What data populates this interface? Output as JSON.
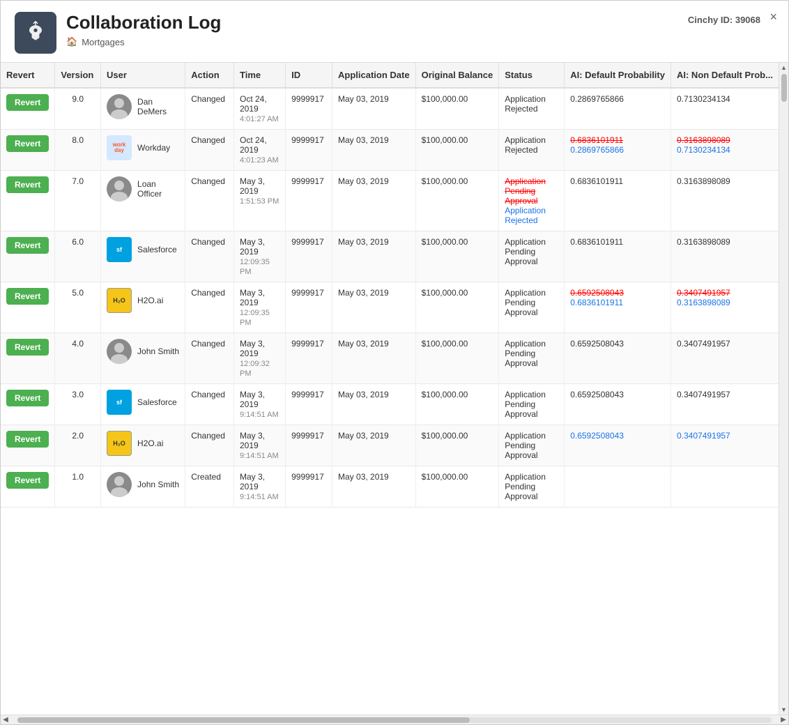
{
  "header": {
    "title": "Collaboration Log",
    "subtitle": "Mortgages",
    "cinchy_label": "Cinchy ID:",
    "cinchy_id": "39068",
    "close_label": "×"
  },
  "table": {
    "columns": [
      "Revert",
      "Version",
      "User",
      "Action",
      "Time",
      "ID",
      "Application Date",
      "Original Balance",
      "Status",
      "AI: Default Probability",
      "AI: Non Default Prob..."
    ],
    "rows": [
      {
        "revert": true,
        "version": "9.0",
        "user_name": "Dan DeMers",
        "user_type": "person",
        "action": "Changed",
        "time_primary": "Oct 24, 2019",
        "time_secondary": "4:01:27 AM",
        "id": "9999917",
        "app_date": "May 03, 2019",
        "original_balance": "$100,000.00",
        "status": [
          {
            "text": "Application Rejected",
            "type": "normal"
          }
        ],
        "ai_default": [
          {
            "text": "0.2869765866",
            "type": "normal"
          }
        ],
        "ai_non_default": [
          {
            "text": "0.7130234134",
            "type": "normal"
          }
        ]
      },
      {
        "revert": true,
        "version": "8.0",
        "user_name": "Workday",
        "user_type": "workday",
        "action": "Changed",
        "time_primary": "Oct 24, 2019",
        "time_secondary": "4:01:23 AM",
        "id": "9999917",
        "app_date": "May 03, 2019",
        "original_balance": "$100,000.00",
        "status": [
          {
            "text": "Application Rejected",
            "type": "normal"
          }
        ],
        "ai_default": [
          {
            "text": "0.6836101911",
            "type": "strikethrough"
          },
          {
            "text": "0.2869765866",
            "type": "new"
          }
        ],
        "ai_non_default": [
          {
            "text": "0.3163898089",
            "type": "strikethrough"
          },
          {
            "text": "0.7130234134",
            "type": "new"
          }
        ]
      },
      {
        "revert": true,
        "version": "7.0",
        "user_name": "Loan Officer",
        "user_type": "person2",
        "action": "Changed",
        "time_primary": "May 3, 2019",
        "time_secondary": "1:51:53 PM",
        "id": "9999917",
        "app_date": "May 03, 2019",
        "original_balance": "$100,000.00",
        "status": [
          {
            "text": "Application Pending Approval",
            "type": "strikethrough"
          },
          {
            "text": "Application Rejected",
            "type": "new"
          }
        ],
        "ai_default": [
          {
            "text": "0.6836101911",
            "type": "normal"
          }
        ],
        "ai_non_default": [
          {
            "text": "0.3163898089",
            "type": "normal"
          }
        ]
      },
      {
        "revert": true,
        "version": "6.0",
        "user_name": "Salesforce",
        "user_type": "salesforce",
        "action": "Changed",
        "time_primary": "May 3, 2019",
        "time_secondary": "12:09:35 PM",
        "id": "9999917",
        "app_date": "May 03, 2019",
        "original_balance": "$100,000.00",
        "status": [
          {
            "text": "Application Pending Approval",
            "type": "normal"
          }
        ],
        "ai_default": [
          {
            "text": "0.6836101911",
            "type": "normal"
          }
        ],
        "ai_non_default": [
          {
            "text": "0.3163898089",
            "type": "normal"
          }
        ]
      },
      {
        "revert": true,
        "version": "5.0",
        "user_name": "H2O.ai",
        "user_type": "h2o",
        "action": "Changed",
        "time_primary": "May 3, 2019",
        "time_secondary": "12:09:35 PM",
        "id": "9999917",
        "app_date": "May 03, 2019",
        "original_balance": "$100,000.00",
        "status": [
          {
            "text": "Application Pending Approval",
            "type": "normal"
          }
        ],
        "ai_default": [
          {
            "text": "0.6592508043",
            "type": "strikethrough"
          },
          {
            "text": "0.6836101911",
            "type": "new"
          }
        ],
        "ai_non_default": [
          {
            "text": "0.3407491957",
            "type": "strikethrough"
          },
          {
            "text": "0.3163898089",
            "type": "new"
          }
        ]
      },
      {
        "revert": true,
        "version": "4.0",
        "user_name": "John Smith",
        "user_type": "person3",
        "action": "Changed",
        "time_primary": "May 3, 2019",
        "time_secondary": "12:09:32 PM",
        "id": "9999917",
        "app_date": "May 03, 2019",
        "original_balance": "$100,000.00",
        "status": [
          {
            "text": "Application Pending Approval",
            "type": "normal"
          }
        ],
        "ai_default": [
          {
            "text": "0.6592508043",
            "type": "normal"
          }
        ],
        "ai_non_default": [
          {
            "text": "0.3407491957",
            "type": "normal"
          }
        ]
      },
      {
        "revert": true,
        "version": "3.0",
        "user_name": "Salesforce",
        "user_type": "salesforce",
        "action": "Changed",
        "time_primary": "May 3, 2019",
        "time_secondary": "9:14:51 AM",
        "id": "9999917",
        "app_date": "May 03, 2019",
        "original_balance": "$100,000.00",
        "status": [
          {
            "text": "Application Pending Approval",
            "type": "normal"
          }
        ],
        "ai_default": [
          {
            "text": "0.6592508043",
            "type": "normal"
          }
        ],
        "ai_non_default": [
          {
            "text": "0.3407491957",
            "type": "normal"
          }
        ]
      },
      {
        "revert": true,
        "version": "2.0",
        "user_name": "H2O.ai",
        "user_type": "h2o",
        "action": "Changed",
        "time_primary": "May 3, 2019",
        "time_secondary": "9:14:51 AM",
        "id": "9999917",
        "app_date": "May 03, 2019",
        "original_balance": "$100,000.00",
        "status": [
          {
            "text": "Application Pending Approval",
            "type": "normal"
          }
        ],
        "ai_default": [
          {
            "text": "0.6592508043",
            "type": "new-blue"
          }
        ],
        "ai_non_default": [
          {
            "text": "0.3407491957",
            "type": "new-blue"
          }
        ]
      },
      {
        "revert": true,
        "version": "1.0",
        "user_name": "John Smith",
        "user_type": "person3",
        "action": "Created",
        "time_primary": "May 3, 2019",
        "time_secondary": "9:14:51 AM",
        "id": "9999917",
        "app_date": "May 03, 2019",
        "original_balance": "$100,000.00",
        "status": [
          {
            "text": "Application Pending Approval",
            "type": "normal"
          }
        ],
        "ai_default": [],
        "ai_non_default": []
      }
    ]
  },
  "buttons": {
    "revert": "Revert"
  }
}
